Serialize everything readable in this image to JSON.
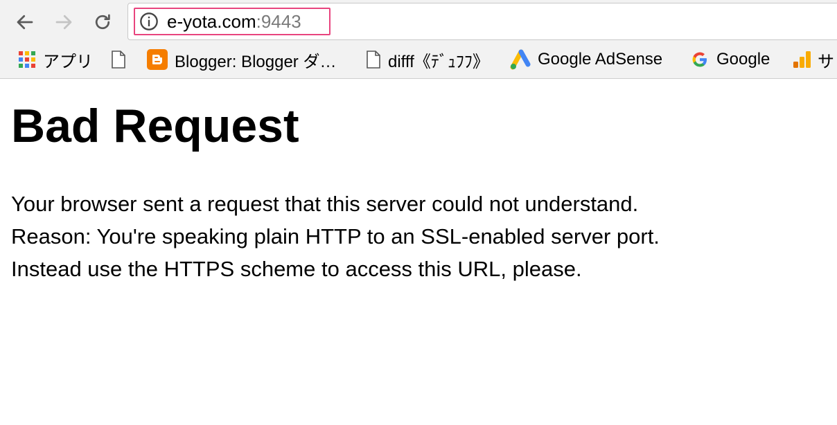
{
  "toolbar": {
    "back_icon": "arrow-left-icon",
    "forward_icon": "arrow-right-icon",
    "reload_icon": "reload-icon"
  },
  "address_bar": {
    "host": "e-yota.com",
    "port": ":9443",
    "info_icon": "info-circle-icon",
    "highlight_color": "#e8447e"
  },
  "bookmarks": [
    {
      "label": "アプリ",
      "icon": "apps-grid-icon"
    },
    {
      "label": "",
      "icon": "page-icon"
    },
    {
      "label": "Blogger: Blogger ダ…",
      "icon": "blogger-icon"
    },
    {
      "label": "difff《ﾃﾞｭﾌﾌ》",
      "icon": "page-icon"
    },
    {
      "label": "Google AdSense",
      "icon": "adsense-icon"
    },
    {
      "label": "Google",
      "icon": "google-g-icon"
    },
    {
      "label": "サ",
      "icon": "analytics-icon"
    }
  ],
  "page": {
    "title": "Bad Request",
    "lines": [
      "Your browser sent a request that this server could not understand.",
      "Reason: You're speaking plain HTTP to an SSL-enabled server port.",
      "Instead use the HTTPS scheme to access this URL, please."
    ]
  }
}
